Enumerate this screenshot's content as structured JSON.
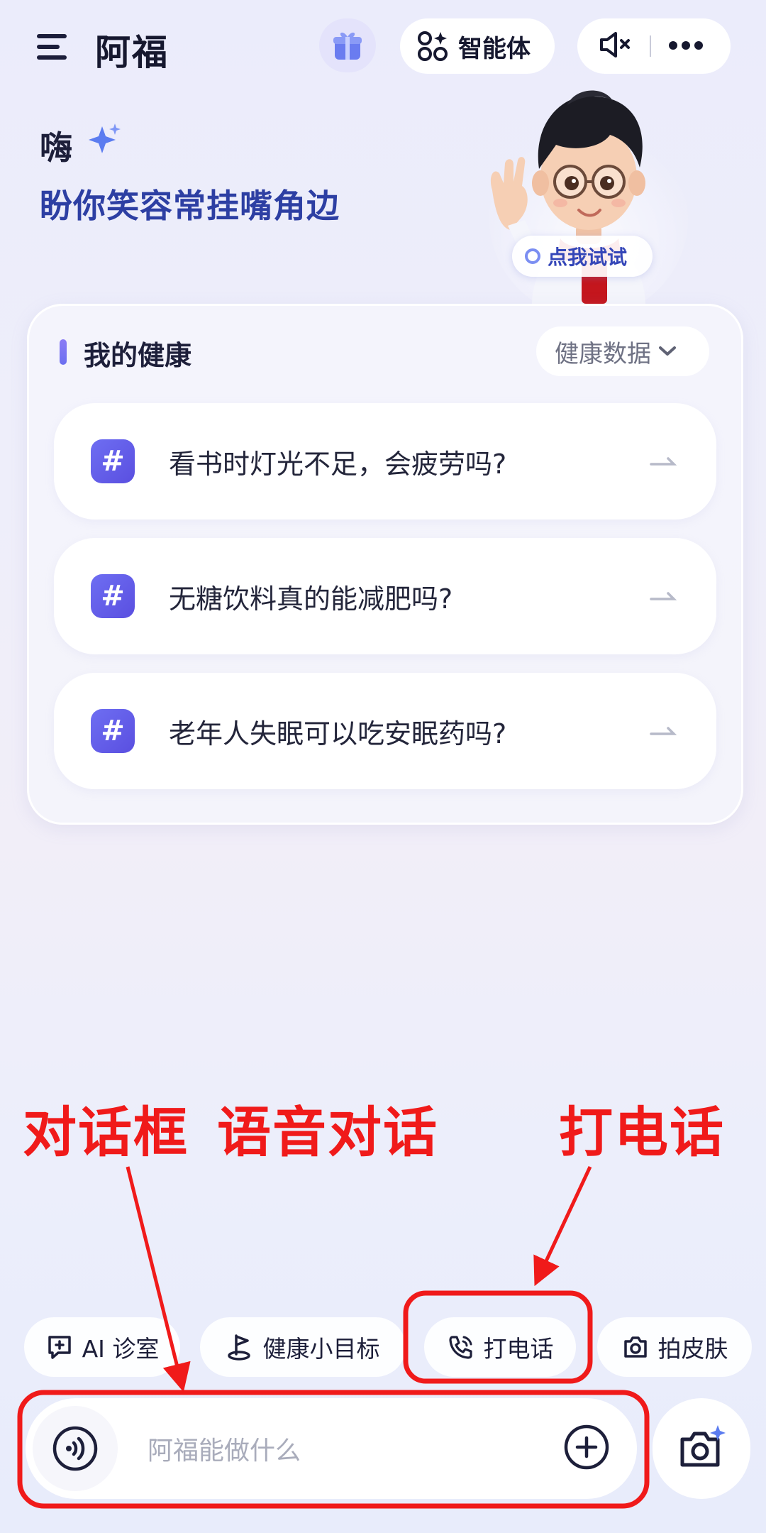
{
  "header": {
    "app_title": "阿福",
    "agent_label": "智能体"
  },
  "greeting": {
    "hi": "嗨",
    "subtitle": "盼你笑容常挂嘴角边"
  },
  "avatar": {
    "try_label": "点我试试"
  },
  "health": {
    "title": "我的健康",
    "data_button": "健康数据",
    "questions": [
      "看书时灯光不足，会疲劳吗?",
      "无糖饮料真的能减肥吗?",
      "老年人失眠可以吃安眠药吗?"
    ]
  },
  "annotations": {
    "dialog_box": "对话框",
    "voice_chat": "语音对话",
    "phone_call": "打电话"
  },
  "chips": [
    "AI 诊室",
    "健康小目标",
    "打电话",
    "拍皮肤"
  ],
  "input": {
    "placeholder": "阿福能做什么"
  },
  "colors": {
    "accent": "#5a4fe0",
    "annotation_red": "#f01a1a",
    "greeting_blue": "#2d3fa3"
  }
}
